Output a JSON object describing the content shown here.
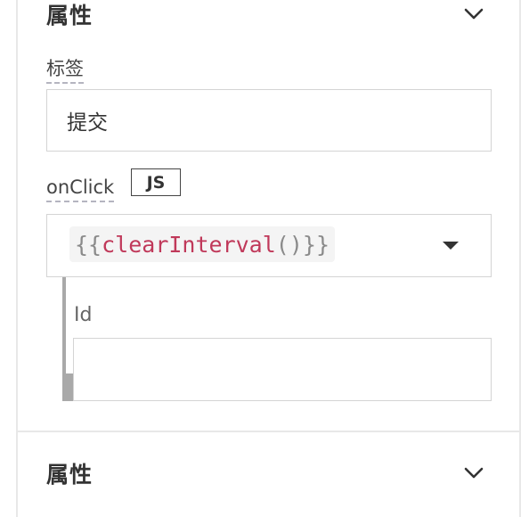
{
  "sections": [
    {
      "title": "属性",
      "expanded": true
    },
    {
      "title": "属性",
      "expanded": false
    }
  ],
  "label_field": {
    "label": "标签",
    "value": "提交"
  },
  "onclick_field": {
    "label": "onClick",
    "js_badge": "JS",
    "code": {
      "open": "{{",
      "func": "clearInterval",
      "parens": "()",
      "close": "}}"
    }
  },
  "id_field": {
    "label": "Id",
    "value": ""
  },
  "colors": {
    "code_function": "#c0395a",
    "code_punctuation": "#8a8a8a",
    "border": "#d4d4d4"
  },
  "icons": [
    "chevron-down-icon",
    "caret-down-icon"
  ]
}
